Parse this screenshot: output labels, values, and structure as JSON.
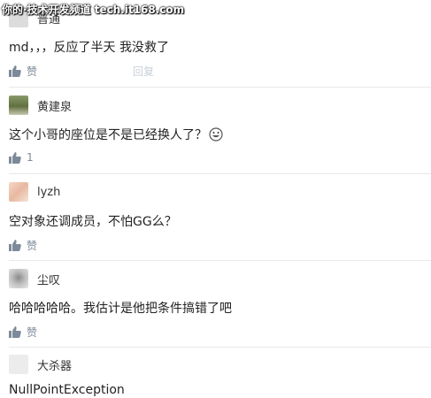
{
  "watermark": "你的·技术开发频道 tech.it168.com",
  "comments": [
    {
      "username": "普通",
      "text": "md，，，反应了半天 我没救了",
      "like_label": "赞",
      "reply_label": "回复"
    },
    {
      "username": "黄建泉",
      "text": "这个小哥的座位是不是已经换人了？",
      "emoji": "grinning-face-icon",
      "like_count": "1"
    },
    {
      "username": "lyzh",
      "text": "空对象还调成员，不怕GG么？",
      "like_label": "赞"
    },
    {
      "username": "尘叹",
      "text": "哈哈哈哈哈。我估计是他把条件搞错了吧",
      "like_label": "赞"
    },
    {
      "username": "大杀器",
      "text": "NullPointException"
    }
  ],
  "colors": {
    "divider": "#e8e8e8",
    "meta": "#7d8a99",
    "text": "#222222"
  }
}
